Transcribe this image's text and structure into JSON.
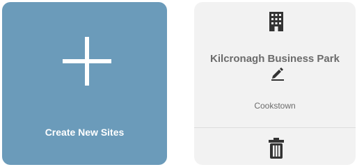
{
  "create_card": {
    "label": "Create New Sites",
    "icon": "plus-icon",
    "color": "#6b9bba"
  },
  "site_card": {
    "name": "Kilcronagh Business Park",
    "town": "Cookstown",
    "icons": {
      "building": "building-icon",
      "edit": "pencil-icon",
      "delete": "trash-icon"
    }
  }
}
